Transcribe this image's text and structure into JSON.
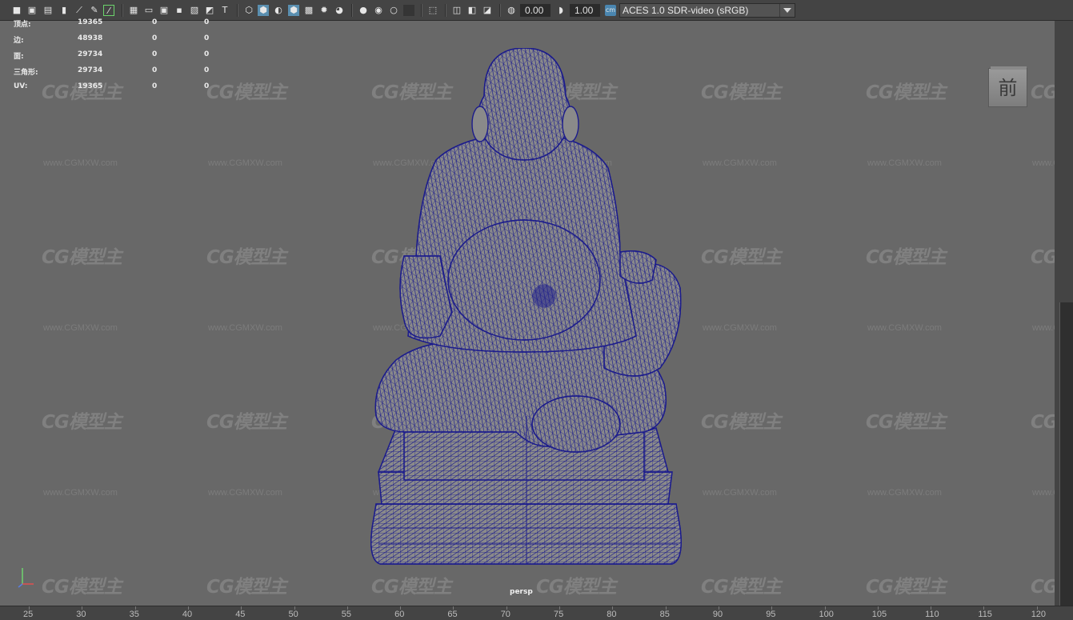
{
  "toolbar": {
    "exposure_value": "0.00",
    "gamma_value": "1.00",
    "color_space": "ACES 1.0 SDR-video (sRGB)",
    "icons": [
      "camera-select-icon",
      "camera-attributes-icon",
      "image-plane-icon",
      "bookmark-icon",
      "2d-pan-zoom-icon",
      "grease-pencil-icon",
      "frame-all-icon",
      "grid-icon",
      "film-gate-icon",
      "resolution-gate-icon",
      "gate-mask-icon",
      "field-chart-icon",
      "safe-action-icon",
      "safe-title-icon",
      "wireframe-icon",
      "smooth-shade-icon",
      "default-material-icon",
      "wireframe-on-shaded-icon",
      "x-ray-icon",
      "use-all-lights-icon",
      "shadows-icon",
      "screen-space-ao-icon",
      "motion-blur-icon",
      "multisample-aa-icon",
      "depth-of-field-icon",
      "isolate-select-icon",
      "xray-joints-icon",
      "xray-active-icon",
      "backface-culling-icon",
      "exposure-icon",
      "gamma-icon",
      "color-management-icon"
    ]
  },
  "hud": {
    "rows": [
      {
        "label": "顶点:",
        "v1": "19365",
        "v2": "0",
        "v3": "0"
      },
      {
        "label": "边:",
        "v1": "48938",
        "v2": "0",
        "v3": "0"
      },
      {
        "label": "面:",
        "v1": "29734",
        "v2": "0",
        "v3": "0"
      },
      {
        "label": "三角形:",
        "v1": "29734",
        "v2": "0",
        "v3": "0"
      },
      {
        "label": "UV:",
        "v1": "19365",
        "v2": "0",
        "v3": "0"
      }
    ]
  },
  "view_cube_label": "前",
  "camera_label": "persp",
  "watermark": {
    "logo": "CG模型主",
    "url": "www.CGMXW.com"
  },
  "timeline": {
    "labels": [
      "25",
      "30",
      "35",
      "40",
      "45",
      "50",
      "55",
      "60",
      "65",
      "70",
      "75",
      "80",
      "85",
      "90",
      "95",
      "100",
      "105",
      "110",
      "115",
      "120"
    ]
  }
}
